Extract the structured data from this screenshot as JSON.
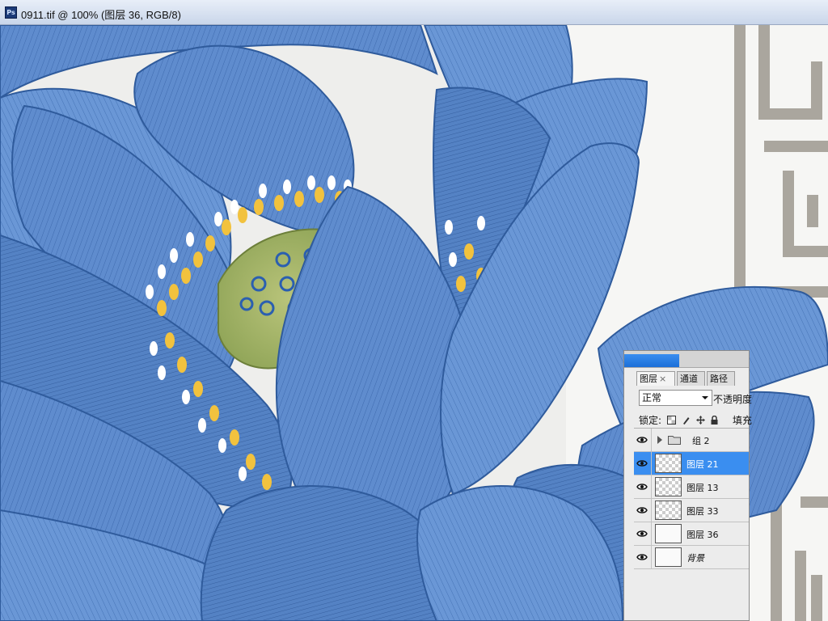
{
  "window": {
    "title": "0911.tif @ 100% (图层 36, RGB/8)",
    "app_icon": "photoshop-icon"
  },
  "layers_panel": {
    "tabs": [
      {
        "label": "图层",
        "close": "×",
        "active": true
      },
      {
        "label": "通道",
        "active": false
      },
      {
        "label": "路径",
        "active": false
      }
    ],
    "blend_mode": "正常",
    "opacity_label": "不透明度",
    "lock_label": "锁定:",
    "lock_icons": [
      "lock-transparent-icon",
      "lock-paint-icon",
      "lock-move-icon",
      "lock-all-icon"
    ],
    "fill_label": "填充",
    "accent_color": "#3a8ef0",
    "layers": [
      {
        "type": "group",
        "name": "组 2",
        "visible": true
      },
      {
        "type": "layer",
        "name": "图层 21",
        "visible": true,
        "selected": true
      },
      {
        "type": "layer",
        "name": "图层 13",
        "visible": true
      },
      {
        "type": "layer",
        "name": "图层 33",
        "visible": true
      },
      {
        "type": "layer",
        "name": "图层 36",
        "visible": true
      },
      {
        "type": "background",
        "name": "背景",
        "visible": true
      }
    ]
  },
  "canvas": {
    "content": "blue-lotus-artwork",
    "petal_color": "#5a86c8",
    "stamen_color": "#f2c23e",
    "border_color": "#a8a49c"
  }
}
